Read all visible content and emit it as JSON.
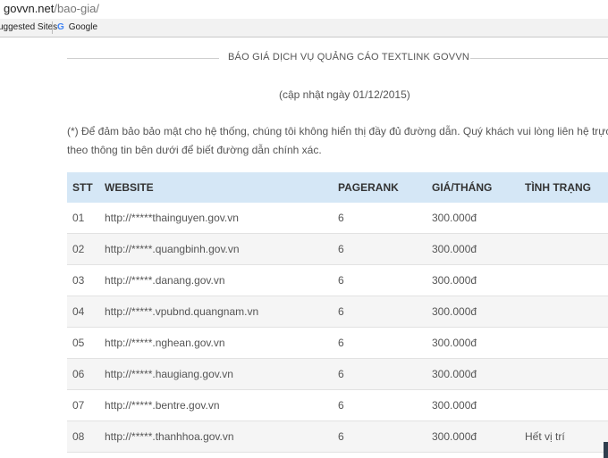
{
  "browser": {
    "url_domain": "govvn.net",
    "url_path": "/bao-gia/",
    "bookmarks": [
      "uggested Sites",
      "Google"
    ]
  },
  "page": {
    "heading": "BÁO GIÁ DỊCH VỤ QUẢNG CÁO TEXTLINK GOVVN",
    "updated": "(cập nhật ngày 01/12/2015)",
    "note_line1": "(*) Để đảm bảo bảo mật cho hệ thống, chúng tôi không hiển thị đầy đủ đường dẫn. Quý khách vui lòng liên hệ trực tiếp",
    "note_line2": "theo thông tin bên dưới để biết đường dẫn chính xác."
  },
  "table": {
    "headers": [
      "STT",
      "WEBSITE",
      "PAGERANK",
      "GIÁ/THÁNG",
      "TÌNH TRẠNG"
    ],
    "rows": [
      {
        "stt": "01",
        "website": "http://*****thainguyen.gov.vn",
        "pagerank": "6",
        "price": "300.000đ",
        "status": ""
      },
      {
        "stt": "02",
        "website": "http://*****.quangbinh.gov.vn",
        "pagerank": "6",
        "price": "300.000đ",
        "status": ""
      },
      {
        "stt": "03",
        "website": "http://*****.danang.gov.vn",
        "pagerank": "6",
        "price": "300.000đ",
        "status": ""
      },
      {
        "stt": "04",
        "website": "http://*****.vpubnd.quangnam.vn",
        "pagerank": "6",
        "price": "300.000đ",
        "status": ""
      },
      {
        "stt": "05",
        "website": "http://*****.nghean.gov.vn",
        "pagerank": "6",
        "price": "300.000đ",
        "status": ""
      },
      {
        "stt": "06",
        "website": "http://*****.haugiang.gov.vn",
        "pagerank": "6",
        "price": "300.000đ",
        "status": ""
      },
      {
        "stt": "07",
        "website": "http://*****.bentre.gov.vn",
        "pagerank": "6",
        "price": "300.000đ",
        "status": ""
      },
      {
        "stt": "08",
        "website": "http://*****.thanhhoa.gov.vn",
        "pagerank": "6",
        "price": "300.000đ",
        "status": "Hết vị trí"
      }
    ]
  },
  "colors": {
    "header_bg": "#d5e7f6",
    "alt_row_bg": "#f5f5f5",
    "text": "#555555"
  }
}
